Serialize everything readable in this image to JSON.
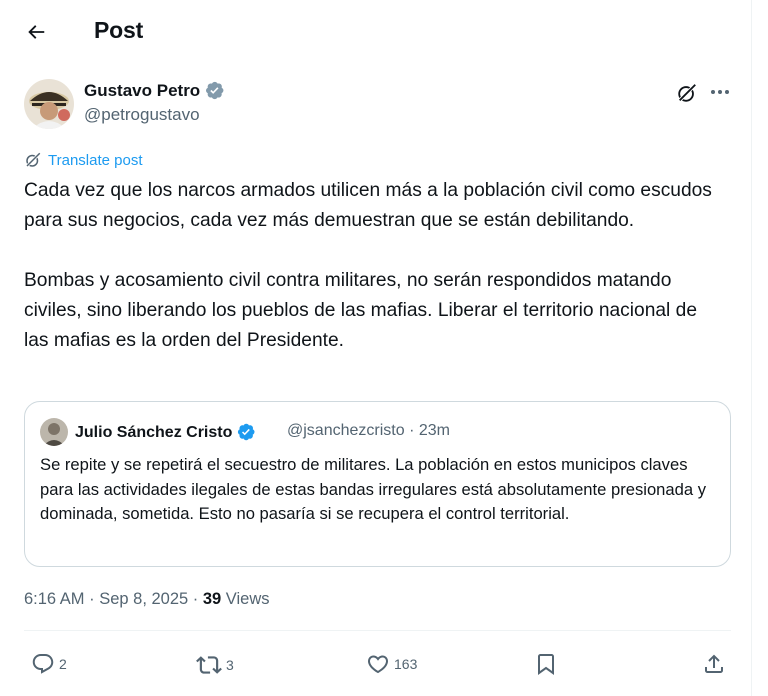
{
  "header": {
    "title": "Post",
    "back_icon": "arrow-left-icon"
  },
  "author": {
    "name": "Gustavo Petro",
    "handle": "@petrogustavo",
    "verified_color": "#829aab"
  },
  "translate_label": "Translate post",
  "post": {
    "paragraphs": [
      "Cada vez que los narcos armados utilicen más a la población civil como escudos para sus negocios, cada vez más demuestran que se están debilitando.",
      "Bombas y acosamiento civil contra militares, no serán respondidos matando civiles, sino liberando los pueblos de las mafias. Liberar el territorio nacional de las mafias es la orden del Presidente."
    ]
  },
  "quote": {
    "name": "Julio Sánchez Cristo",
    "handle_time": "@jsanchezcristo · 23m",
    "verified_color": "#1d9bf0",
    "text": "Se repite y se repetirá el secuestro de militares. La población en estos municipos claves para las actividades ilegales de estas bandas irregulares está absolutamente presionada y dominada, sometida. Esto no pasaría si se recupera el control territorial."
  },
  "meta": {
    "timestamp": "6:16 AM · Sep 8, 2025 · ",
    "views_count": "39",
    "views_label": " Views"
  },
  "actions": {
    "replies": "2",
    "retweets": "3",
    "likes": "163"
  },
  "colors": {
    "accent": "#1d9bf0",
    "muted": "#536471",
    "text": "#0f1419",
    "border": "#cfd9de"
  }
}
